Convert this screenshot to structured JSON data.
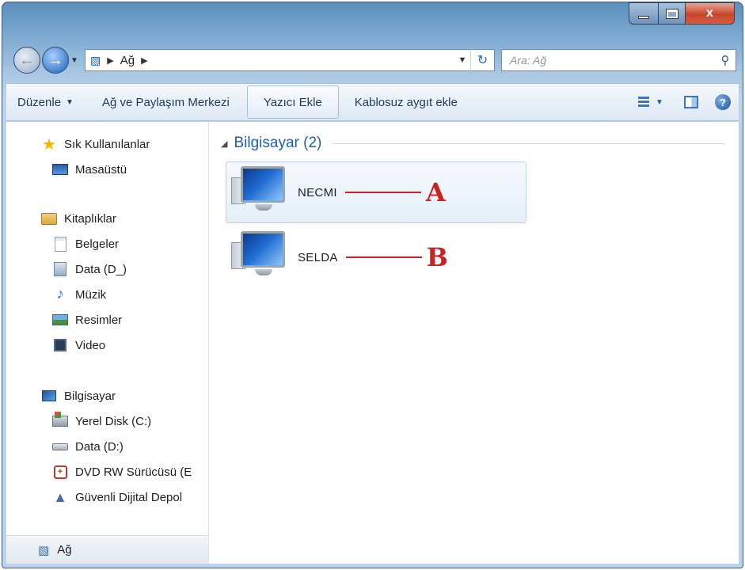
{
  "window": {
    "caption": {
      "min": "",
      "max": "",
      "close": "x"
    }
  },
  "nav": {
    "address_segments": [
      "Ağ"
    ],
    "search_placeholder": "Ara: Ağ"
  },
  "toolbar": {
    "organize": "Düzenle",
    "network_center": "Ağ ve Paylaşım Merkezi",
    "add_printer": "Yazıcı Ekle",
    "add_wireless": "Kablosuz aygıt ekle"
  },
  "sidebar": {
    "favorites": {
      "label": "Sık Kullanılanlar",
      "items": [
        "Masaüstü"
      ]
    },
    "libraries": {
      "label": "Kitaplıklar",
      "items": [
        "Belgeler",
        "Data (D_)",
        "Müzik",
        "Resimler",
        "Video"
      ]
    },
    "computer": {
      "label": "Bilgisayar",
      "items": [
        "Yerel Disk (C:)",
        "Data (D:)",
        "DVD RW Sürücüsü (E",
        "Güvenli Dijital Depol"
      ]
    },
    "network": {
      "label": "Ağ"
    }
  },
  "content": {
    "group_title": "Bilgisayar (2)",
    "items": [
      {
        "name": "NECMI",
        "annotation": "A",
        "selected": true
      },
      {
        "name": "SELDA",
        "annotation": "B",
        "selected": false
      }
    ]
  },
  "colors": {
    "annotation": "#cc2222",
    "group_title": "#1e5eb0",
    "frame": "#7aa7cf"
  }
}
